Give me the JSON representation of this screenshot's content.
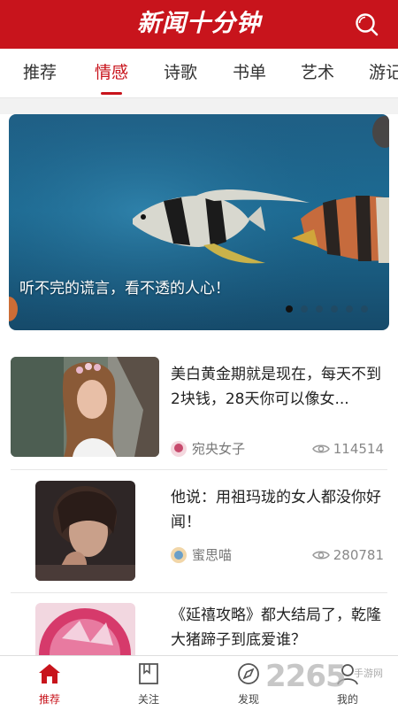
{
  "header": {
    "title": "新闻十分钟",
    "search_icon": "search-icon"
  },
  "tabs": [
    {
      "label": "推荐",
      "active": false
    },
    {
      "label": "情感",
      "active": true
    },
    {
      "label": "诗歌",
      "active": false
    },
    {
      "label": "书单",
      "active": false
    },
    {
      "label": "艺术",
      "active": false
    },
    {
      "label": "游记",
      "active": false
    }
  ],
  "banner": {
    "caption": "听不完的谎言，看不透的人心！",
    "slide_count": 6,
    "active_slide": 1
  },
  "articles": [
    {
      "title": "美白黄金期就是现在，每天不到2块钱，28天你可以像女...",
      "author": "宛央女子",
      "views": "114514"
    },
    {
      "title": "他说：用祖玛珑的女人都没你好闻！",
      "author": "蜜思喵",
      "views": "280781"
    },
    {
      "title": "《延禧攻略》都大结局了，乾隆大猪蹄子到底爱谁？",
      "author": "",
      "views": ""
    }
  ],
  "bottom_nav": [
    {
      "label": "推荐",
      "icon": "home-icon",
      "active": true
    },
    {
      "label": "关注",
      "icon": "bookmark-book-icon",
      "active": false
    },
    {
      "label": "发现",
      "icon": "compass-icon",
      "active": false
    },
    {
      "label": "我的",
      "icon": "profile-icon",
      "active": false
    }
  ],
  "watermark": {
    "text": "2265",
    "sub": "手游网"
  },
  "colors": {
    "brand": "#c8141c"
  }
}
